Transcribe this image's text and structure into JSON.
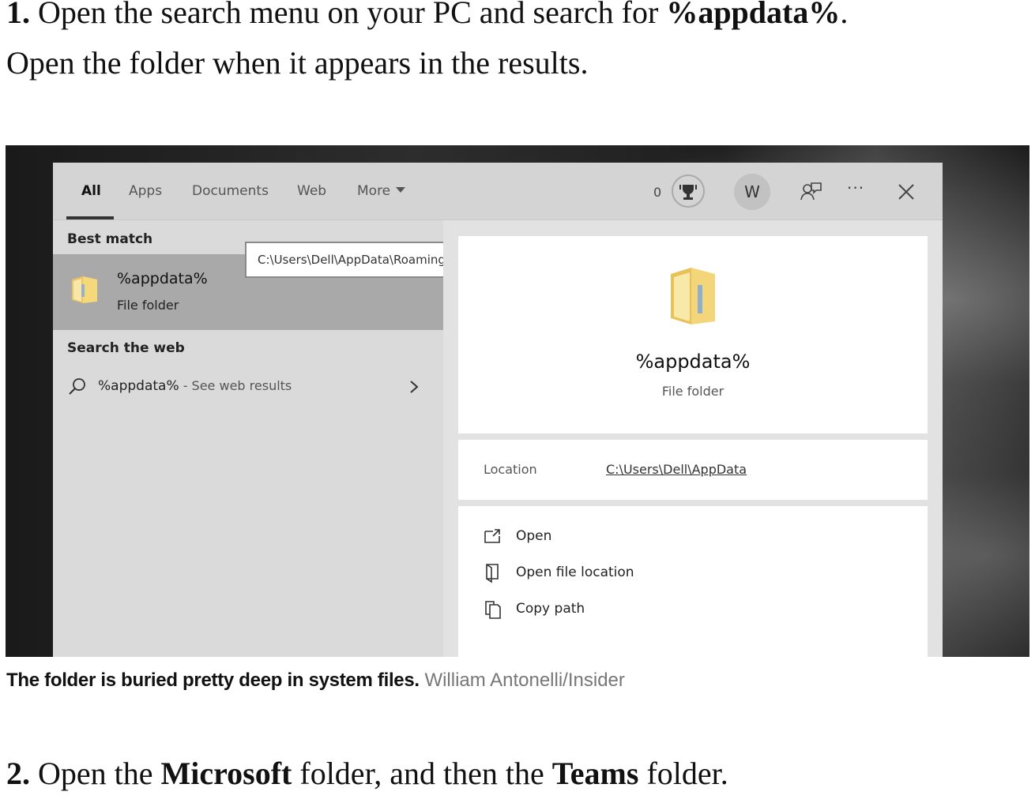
{
  "step1": {
    "number": "1.",
    "text_a": " Open the search menu on your PC and search for ",
    "bold": "%appdata%",
    "text_b": ".",
    "line2": "Open the folder when it appears in the results."
  },
  "search_ui": {
    "tabs": [
      "All",
      "Apps",
      "Documents",
      "Web",
      "More"
    ],
    "active_tab": "All",
    "rewards_count": "0",
    "avatar_letter": "W",
    "more_menu_label": "···",
    "best_match_header": "Best match",
    "best_match": {
      "title": "%appdata%",
      "subtitle": "File folder"
    },
    "tooltip": "C:\\Users\\Dell\\AppData\\Roaming",
    "search_web_header": "Search the web",
    "web_result": {
      "query": "%appdata%",
      "suffix": " - See web results"
    },
    "detail": {
      "title": "%appdata%",
      "subtitle": "File folder",
      "location_label": "Location",
      "location_value": "C:\\Users\\Dell\\AppData"
    },
    "actions": [
      "Open",
      "Open file location",
      "Copy path"
    ],
    "icons": [
      "rewards-icon",
      "feedback-icon",
      "more-options-icon",
      "close-icon",
      "folder-icon",
      "search-icon",
      "chevron-right-icon",
      "open-icon",
      "open-file-location-icon",
      "copy-path-icon"
    ],
    "colors": {
      "selected_row": "#a9a9a9",
      "panel": "#dadada",
      "card": "#ffffff"
    }
  },
  "caption": {
    "bold": "The folder is buried pretty deep in system files.",
    "credit": " William Antonelli/Insider"
  },
  "step2": {
    "number": "2.",
    "t1": " Open the ",
    "b1": "Microsoft",
    "t2": " folder, and then the ",
    "b2": "Teams",
    "t3": " folder."
  }
}
